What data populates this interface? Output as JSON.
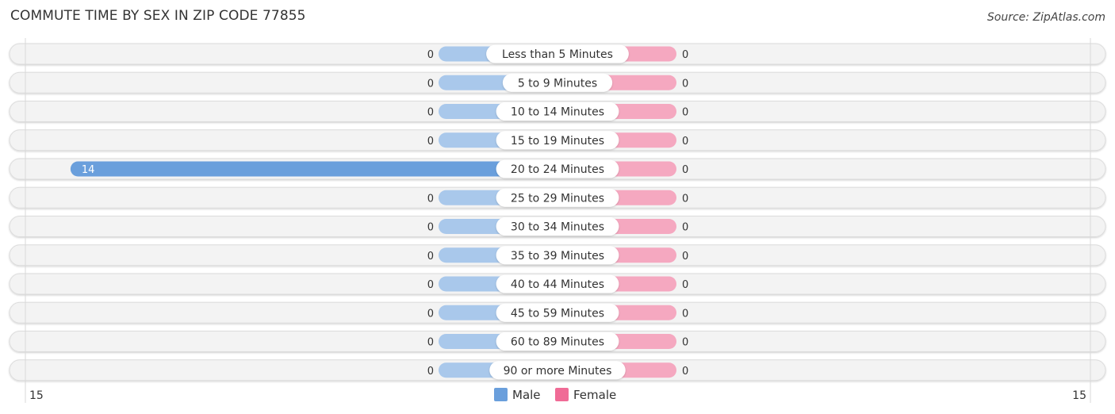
{
  "header": {
    "title": "COMMUTE TIME BY SEX IN ZIP CODE 77855",
    "source": "Source: ZipAtlas.com"
  },
  "chart_data": {
    "type": "bar",
    "orientation": "horizontal-diverging",
    "title": "COMMUTE TIME BY SEX IN ZIP CODE 77855",
    "categories": [
      "Less than 5 Minutes",
      "5 to 9 Minutes",
      "10 to 14 Minutes",
      "15 to 19 Minutes",
      "20 to 24 Minutes",
      "25 to 29 Minutes",
      "30 to 34 Minutes",
      "35 to 39 Minutes",
      "40 to 44 Minutes",
      "45 to 59 Minutes",
      "60 to 89 Minutes",
      "90 or more Minutes"
    ],
    "series": [
      {
        "name": "Male",
        "color": "#6a9fdc",
        "light_color": "#a9c8eb",
        "values": [
          0,
          0,
          0,
          0,
          14,
          0,
          0,
          0,
          0,
          0,
          0,
          0
        ]
      },
      {
        "name": "Female",
        "color": "#f06b96",
        "light_color": "#f5a8c0",
        "values": [
          0,
          0,
          0,
          0,
          0,
          0,
          0,
          0,
          0,
          0,
          0,
          0
        ]
      }
    ],
    "xlim": [
      15,
      15
    ],
    "axis_tick_labels": {
      "left": "15",
      "right": "15"
    },
    "legend": {
      "position": "bottom-center",
      "entries": [
        "Male",
        "Female"
      ]
    },
    "grid": false
  }
}
